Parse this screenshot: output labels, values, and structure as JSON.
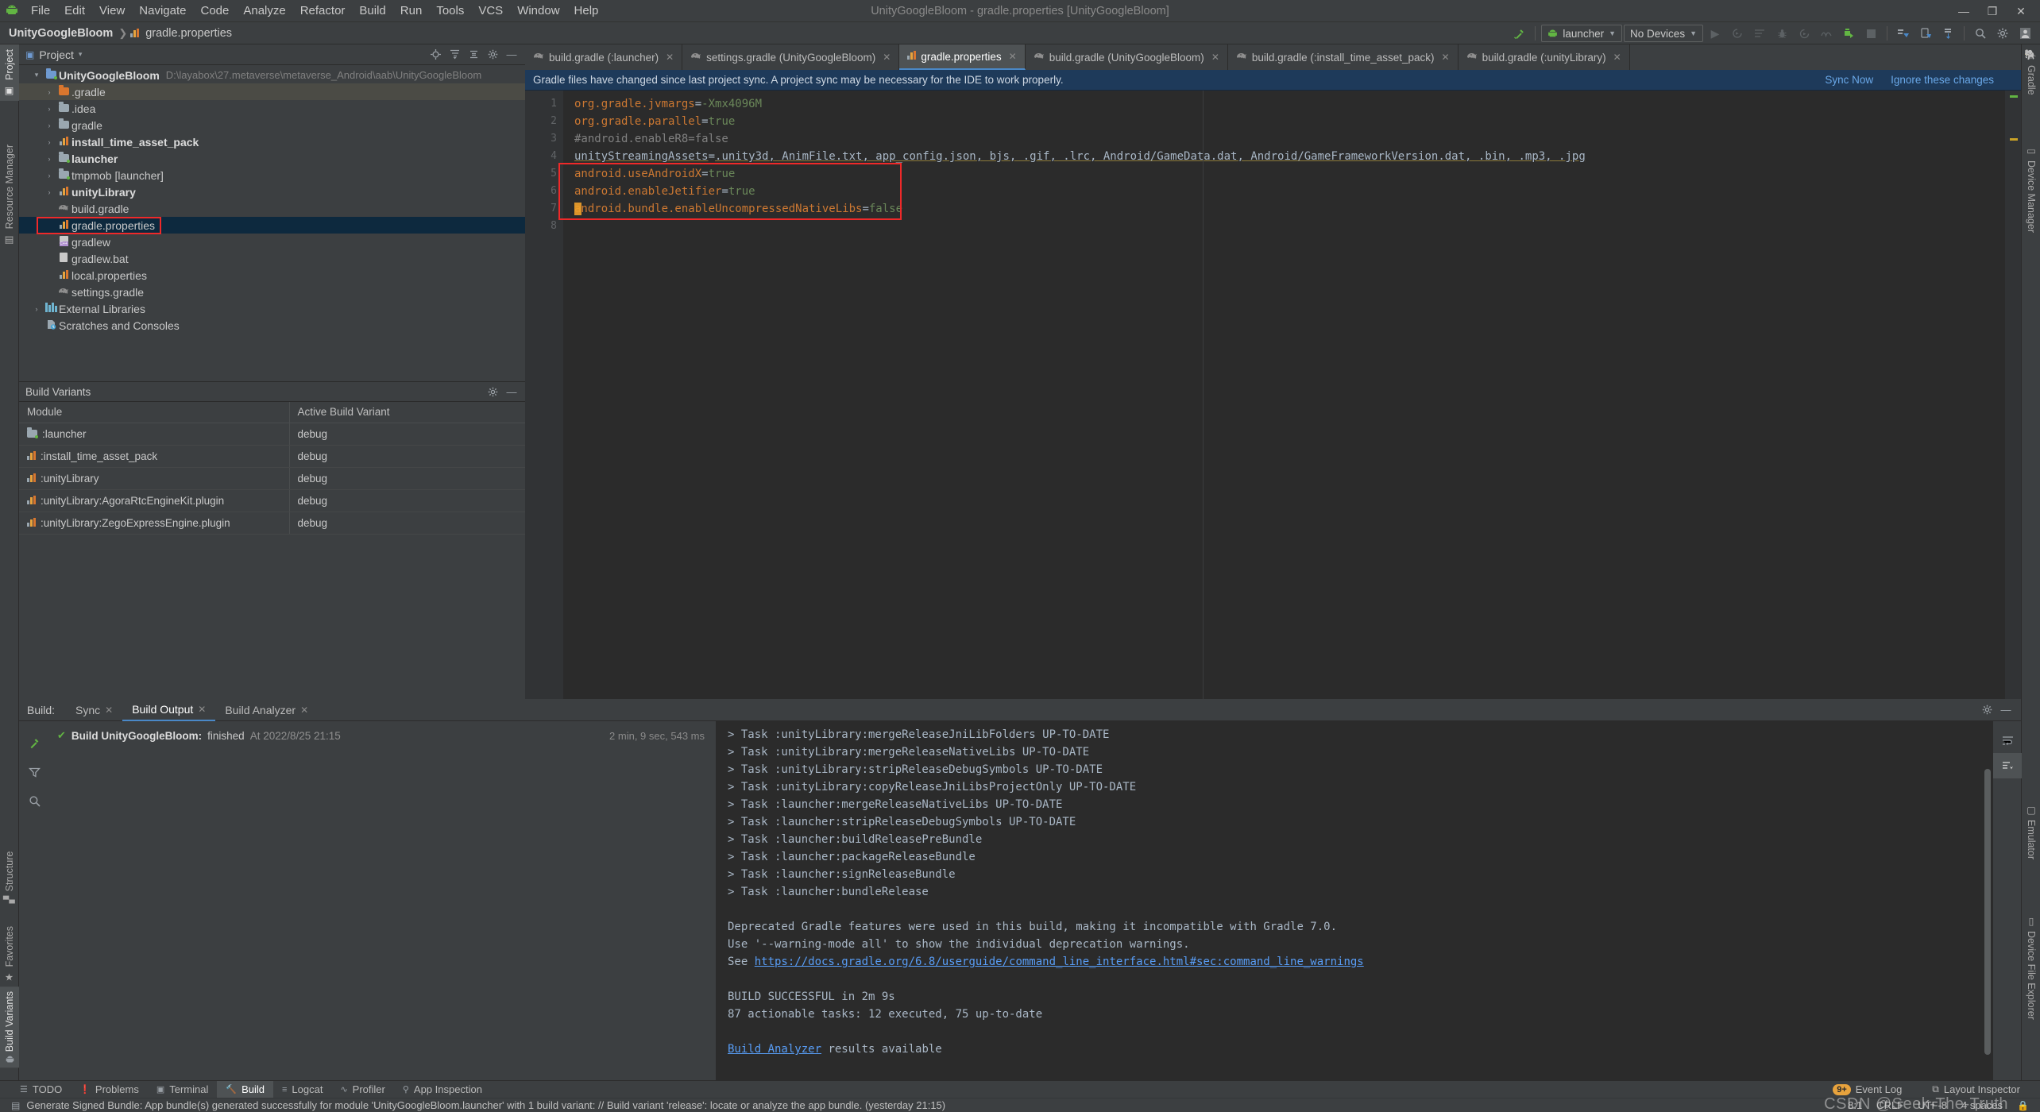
{
  "window": {
    "title": "UnityGoogleBloom - gradle.properties [UnityGoogleBloom]",
    "minimize": "—",
    "maximize": "❐",
    "close": "✕"
  },
  "menubar": {
    "logo": "android-robot-icon",
    "items": [
      "File",
      "Edit",
      "View",
      "Navigate",
      "Code",
      "Analyze",
      "Refactor",
      "Build",
      "Run",
      "Tools",
      "VCS",
      "Window",
      "Help"
    ]
  },
  "breadcrumb": {
    "project": "UnityGoogleBloom",
    "separator": "❯",
    "file": "gradle.properties"
  },
  "toolbar": {
    "build_hammer": "hammer-icon",
    "run_config": "launcher",
    "device_select": "No Devices",
    "icons": [
      "run-icon",
      "debug-attach-icon",
      "build-icon",
      "bug-icon",
      "run-coverage-icon",
      "profile-icon",
      "apply-changes-icon",
      "stop-icon",
      "sdk-manager-icon",
      "avd-manager-icon",
      "sync-project-icon",
      "search-icon",
      "settings-icon",
      "account-icon"
    ]
  },
  "left_strip": {
    "top": [
      {
        "label": "Project",
        "icon": "project-icon",
        "active": true
      },
      {
        "label": "Resource Manager",
        "icon": "resource-manager-icon",
        "active": false
      }
    ],
    "bottom": [
      {
        "label": "Structure",
        "icon": "structure-icon",
        "active": false
      },
      {
        "label": "Favorites",
        "icon": "star-icon",
        "active": false
      },
      {
        "label": "Build Variants",
        "icon": "android-icon",
        "active": true
      }
    ]
  },
  "right_strip": [
    {
      "label": "Gradle",
      "icon": "gradle-elephant-icon"
    },
    {
      "label": "Device Manager",
      "icon": "device-manager-icon"
    },
    {
      "label": "Emulator",
      "icon": "emulator-icon"
    },
    {
      "label": "Device File Explorer",
      "icon": "device-file-explorer-icon"
    }
  ],
  "project_panel": {
    "title": "Project",
    "caret": "▾",
    "header_actions": [
      "locate-icon",
      "expand-all-icon",
      "collapse-all-icon",
      "settings-icon",
      "hide-icon"
    ],
    "tree": [
      {
        "depth": 0,
        "arrow": "▾",
        "icon": "module-folder-icon",
        "icon_color": "#6f9ad1",
        "label": "UnityGoogleBloom",
        "bold": true,
        "path": "D:\\layabox\\27.metaverse\\metaverse_Android\\aab\\UnityGoogleBloom",
        "state": "normal"
      },
      {
        "depth": 1,
        "arrow": "›",
        "icon": "folder-icon",
        "icon_color": "#d9762e",
        "label": ".gradle",
        "bold": false,
        "path": "",
        "state": "hover"
      },
      {
        "depth": 1,
        "arrow": "›",
        "icon": "folder-icon",
        "icon_color": "#9aa7b0",
        "label": ".idea",
        "bold": false,
        "path": "",
        "state": "normal"
      },
      {
        "depth": 1,
        "arrow": "›",
        "icon": "folder-icon",
        "icon_color": "#9aa7b0",
        "label": "gradle",
        "bold": false,
        "path": "",
        "state": "normal"
      },
      {
        "depth": 1,
        "arrow": "›",
        "icon": "gradle-module-icon",
        "icon_color": "#62b543",
        "label": "install_time_asset_pack",
        "bold": true,
        "path": "",
        "state": "normal"
      },
      {
        "depth": 1,
        "arrow": "›",
        "icon": "android-module-icon",
        "icon_color": "#6f9ad1",
        "label": "launcher",
        "bold": true,
        "path": "",
        "state": "normal"
      },
      {
        "depth": 1,
        "arrow": "›",
        "icon": "android-module-icon",
        "icon_color": "#6f9ad1",
        "label": "tmpmob [launcher]",
        "bold": false,
        "path": "",
        "state": "normal"
      },
      {
        "depth": 1,
        "arrow": "›",
        "icon": "gradle-module-icon",
        "icon_color": "#62b543",
        "label": "unityLibrary",
        "bold": true,
        "path": "",
        "state": "normal"
      },
      {
        "depth": 1,
        "arrow": "",
        "icon": "gradle-file-icon",
        "icon_color": "#9aa7b0",
        "label": "build.gradle",
        "bold": false,
        "path": "",
        "state": "normal"
      },
      {
        "depth": 1,
        "arrow": "",
        "icon": "properties-file-icon",
        "icon_color": "#62b543",
        "label": "gradle.properties",
        "bold": false,
        "path": "",
        "state": "selected-highlighted"
      },
      {
        "depth": 1,
        "arrow": "",
        "icon": "shell-file-icon",
        "icon_color": "#b08fd0",
        "label": "gradlew",
        "bold": false,
        "path": "",
        "state": "normal"
      },
      {
        "depth": 1,
        "arrow": "",
        "icon": "bat-file-icon",
        "icon_color": "#9aa7b0",
        "label": "gradlew.bat",
        "bold": false,
        "path": "",
        "state": "normal"
      },
      {
        "depth": 1,
        "arrow": "",
        "icon": "properties-file-icon",
        "icon_color": "#62b543",
        "label": "local.properties",
        "bold": false,
        "path": "",
        "state": "normal"
      },
      {
        "depth": 1,
        "arrow": "",
        "icon": "gradle-file-icon",
        "icon_color": "#9aa7b0",
        "label": "settings.gradle",
        "bold": false,
        "path": "",
        "state": "normal"
      },
      {
        "depth": 0,
        "arrow": "›",
        "icon": "libraries-icon",
        "icon_color": "#6fb5d1",
        "label": "External Libraries",
        "bold": false,
        "path": "",
        "state": "normal"
      },
      {
        "depth": 0,
        "arrow": "",
        "icon": "scratches-icon",
        "icon_color": "#6fb5d1",
        "label": "Scratches and Consoles",
        "bold": false,
        "path": "",
        "state": "normal"
      }
    ]
  },
  "build_variants": {
    "title": "Build Variants",
    "header_actions": [
      "settings-icon",
      "hide-icon"
    ],
    "columns": [
      "Module",
      "Active Build Variant"
    ],
    "rows": [
      {
        "module": ":launcher",
        "icon": "android-module-icon",
        "variant": "debug"
      },
      {
        "module": ":install_time_asset_pack",
        "icon": "gradle-module-icon",
        "variant": "debug"
      },
      {
        "module": ":unityLibrary",
        "icon": "gradle-module-icon",
        "variant": "debug"
      },
      {
        "module": ":unityLibrary:AgoraRtcEngineKit.plugin",
        "icon": "gradle-module-icon",
        "variant": "debug"
      },
      {
        "module": ":unityLibrary:ZegoExpressEngine.plugin",
        "icon": "gradle-module-icon",
        "variant": "debug"
      }
    ]
  },
  "editor": {
    "tabs": [
      {
        "label": "build.gradle (:launcher)",
        "icon": "gradle-file-icon",
        "active": false
      },
      {
        "label": "settings.gradle (UnityGoogleBloom)",
        "icon": "gradle-file-icon",
        "active": false
      },
      {
        "label": "gradle.properties",
        "icon": "properties-file-icon",
        "active": true
      },
      {
        "label": "build.gradle (UnityGoogleBloom)",
        "icon": "gradle-file-icon",
        "active": false
      },
      {
        "label": "build.gradle (:install_time_asset_pack)",
        "icon": "gradle-file-icon",
        "active": false
      },
      {
        "label": "build.gradle (:unityLibrary)",
        "icon": "gradle-file-icon",
        "active": false
      }
    ],
    "tab_close": "✕",
    "banner": {
      "message": "Gradle files have changed since last project sync. A project sync may be necessary for the IDE to work properly.",
      "sync_now": "Sync Now",
      "ignore": "Ignore these changes"
    },
    "line_numbers": [
      "1",
      "2",
      "3",
      "4",
      "5",
      "6",
      "7",
      "8"
    ],
    "lines": [
      {
        "n": 1,
        "key": "org.gradle.jvmargs",
        "eq": "=",
        "value": "-Xmx4096M",
        "kind": "prop"
      },
      {
        "n": 2,
        "key": "org.gradle.parallel",
        "eq": "=",
        "value": "true",
        "kind": "prop"
      },
      {
        "n": 3,
        "key": "#android.enableR8=false",
        "eq": "",
        "value": "",
        "kind": "comment"
      },
      {
        "n": 4,
        "key": "unityStreamingAssets",
        "eq": "=",
        "value": ".unity3d, AnimFile.txt, app_config.json, bjs, .gif, .lrc, Android/GameData.dat, Android/GameFrameworkVersion.dat, .bin, .mp3, .jpg",
        "kind": "prop-underline"
      },
      {
        "n": 5,
        "key": "android.useAndroidX",
        "eq": "=",
        "value": "true",
        "kind": "prop"
      },
      {
        "n": 6,
        "key": "android.enableJetifier",
        "eq": "=",
        "value": "true",
        "kind": "prop"
      },
      {
        "n": 7,
        "key": "android.bundle.enableUncompressedNativeLibs",
        "eq": "=",
        "value": "false",
        "kind": "prop"
      },
      {
        "n": 8,
        "key": "",
        "eq": "",
        "value": "",
        "kind": "empty"
      }
    ]
  },
  "build_output": {
    "lead_label": "Build:",
    "tabs": [
      {
        "label": "Sync",
        "active": false
      },
      {
        "label": "Build Output",
        "active": true
      },
      {
        "label": "Build Analyzer",
        "active": false
      }
    ],
    "tab_close": "✕",
    "header_actions": [
      "settings-icon",
      "hide-icon"
    ],
    "rail_icons": [
      "restart-build-icon",
      "filter-icon",
      "zoom-icon"
    ],
    "side_icons": [
      "soft-wrap-icon",
      "scroll-to-end-icon"
    ],
    "tree_row": {
      "status_icon": "check-icon",
      "name": "Build UnityGoogleBloom:",
      "state": "finished",
      "at": "At 2022/8/25 21:15",
      "duration": "2 min, 9 sec, 543 ms"
    },
    "console": [
      {
        "text": "> Task :unityLibrary:mergeReleaseJniLibFolders UP-TO-DATE",
        "type": "text"
      },
      {
        "text": "> Task :unityLibrary:mergeReleaseNativeLibs UP-TO-DATE",
        "type": "text"
      },
      {
        "text": "> Task :unityLibrary:stripReleaseDebugSymbols UP-TO-DATE",
        "type": "text"
      },
      {
        "text": "> Task :unityLibrary:copyReleaseJniLibsProjectOnly UP-TO-DATE",
        "type": "text"
      },
      {
        "text": "> Task :launcher:mergeReleaseNativeLibs UP-TO-DATE",
        "type": "text"
      },
      {
        "text": "> Task :launcher:stripReleaseDebugSymbols UP-TO-DATE",
        "type": "text"
      },
      {
        "text": "> Task :launcher:buildReleasePreBundle",
        "type": "text"
      },
      {
        "text": "> Task :launcher:packageReleaseBundle",
        "type": "text"
      },
      {
        "text": "> Task :launcher:signReleaseBundle",
        "type": "text"
      },
      {
        "text": "> Task :launcher:bundleRelease",
        "type": "text"
      },
      {
        "text": "",
        "type": "blank"
      },
      {
        "text": "Deprecated Gradle features were used in this build, making it incompatible with Gradle 7.0.",
        "type": "text"
      },
      {
        "text": "Use '--warning-mode all' to show the individual deprecation warnings.",
        "type": "text"
      },
      {
        "text": "See ",
        "type": "link-line",
        "link": "https://docs.gradle.org/6.8/userguide/command_line_interface.html#sec:command_line_warnings"
      },
      {
        "text": "",
        "type": "blank"
      },
      {
        "text": "BUILD SUCCESSFUL in 2m 9s",
        "type": "text"
      },
      {
        "text": "87 actionable tasks: 12 executed, 75 up-to-date",
        "type": "text"
      },
      {
        "text": "",
        "type": "blank"
      },
      {
        "text": " results available",
        "type": "link-prefix",
        "link": "Build Analyzer"
      }
    ]
  },
  "toolwindow_bar": {
    "left": [
      {
        "label": "TODO",
        "icon": "todo-icon",
        "active": false
      },
      {
        "label": "Problems",
        "icon": "problems-icon",
        "active": false
      },
      {
        "label": "Terminal",
        "icon": "terminal-icon",
        "active": false
      },
      {
        "label": "Build",
        "icon": "hammer-icon",
        "active": true
      },
      {
        "label": "Logcat",
        "icon": "logcat-icon",
        "active": false
      },
      {
        "label": "Profiler",
        "icon": "profiler-icon",
        "active": false
      },
      {
        "label": "App Inspection",
        "icon": "app-inspection-icon",
        "active": false
      }
    ],
    "right": [
      {
        "label": "Event Log",
        "icon": "event-log-icon",
        "badge": "9+"
      },
      {
        "label": "Layout Inspector",
        "icon": "layout-inspector-icon",
        "badge": ""
      }
    ]
  },
  "statusbar": {
    "icon": "info-icon",
    "message": "Generate Signed Bundle: App bundle(s) generated successfully for module 'UnityGoogleBloom.launcher' with 1 build variant: // Build variant 'release': locate or analyze the app bundle. (yesterday 21:15)",
    "caret_position": "8:1",
    "line_separator": "CRLF",
    "encoding": "UTF-8",
    "indent": "4 spaces",
    "lock": "lock-icon"
  },
  "watermark": "CSDN @Seek-The-Truth",
  "colors": {
    "bg_panel": "#3c3f41",
    "bg_editor": "#2b2b2b",
    "accent_blue": "#4a88c7",
    "accent_green": "#62b543",
    "banner_bg": "#1e3a5a",
    "selection": "#0d293e",
    "highlight_red": "#ef2929",
    "link": "#589df6"
  }
}
